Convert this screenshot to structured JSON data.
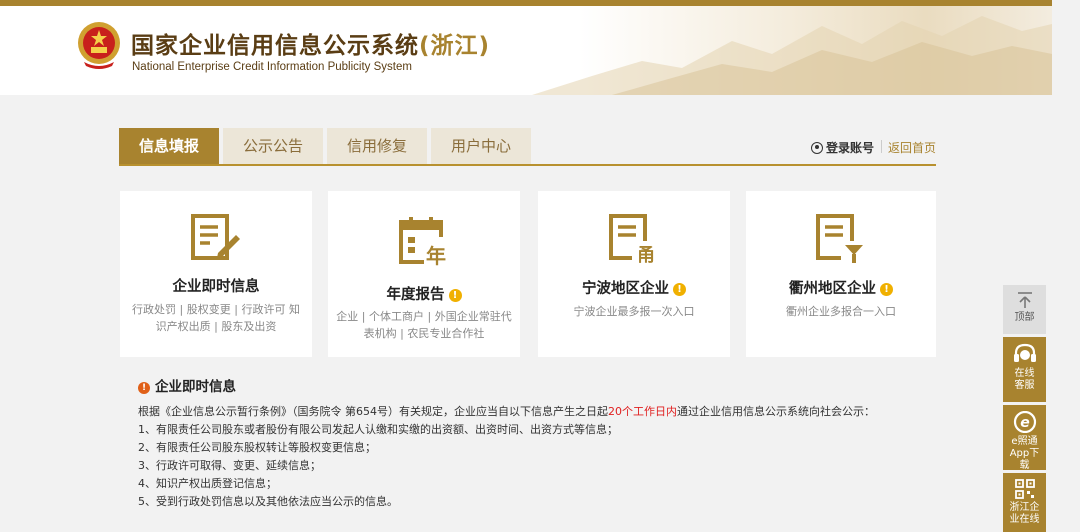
{
  "header": {
    "title_main": "国家企业信用信息公示系统",
    "title_region": "(浙江)",
    "subtitle": "National Enterprise Credit Information Publicity System",
    "accent_color": "#a8832f"
  },
  "nav": {
    "tabs": [
      {
        "label": "信息填报",
        "active": true
      },
      {
        "label": "公示公告",
        "active": false
      },
      {
        "label": "信用修复",
        "active": false
      },
      {
        "label": "用户中心",
        "active": false
      }
    ],
    "login_label": "登录账号",
    "home_label": "返回首页"
  },
  "cards": [
    {
      "title": "企业即时信息",
      "desc": "行政处罚 | 股权变更 | 行政许可 知识产权出质 | 股东及出资",
      "icon": "document-edit-icon"
    },
    {
      "title": "年度报告",
      "desc": "企业 | 个体工商户 | 外国企业常驻代表机构 | 农民专业合作社",
      "icon": "calendar-year-icon"
    },
    {
      "title": "宁波地区企业",
      "desc": "宁波企业最多报一次入口",
      "icon": "document-ningbo-icon"
    },
    {
      "title": "衢州地区企业",
      "desc": "衢州企业多报合一入口",
      "icon": "document-quzhou-icon"
    }
  ],
  "section": {
    "title": "企业即时信息",
    "intro_before": "根据《企业信息公示暂行条例》（国务院令 第654号）有关规定，企业应当自以下信息产生之日起",
    "intro_highlight": "20个工作日内",
    "intro_after": "通过企业信用信息公示系统向社会公示：",
    "rules": [
      "1、有限责任公司股东或者股份有限公司发起人认缴和实缴的出资额、出资时间、出资方式等信息；",
      "2、有限责任公司股东股权转让等股权变更信息；",
      "3、行政许可取得、变更、延续信息；",
      "4、知识产权出质登记信息；",
      "5、受到行政处罚信息以及其他依法应当公示的信息。"
    ]
  },
  "sidebar": {
    "top_label": "顶部",
    "service_label": "在线客服",
    "app_label": "e照通App下载",
    "qr_label": "浙江企业在线"
  }
}
